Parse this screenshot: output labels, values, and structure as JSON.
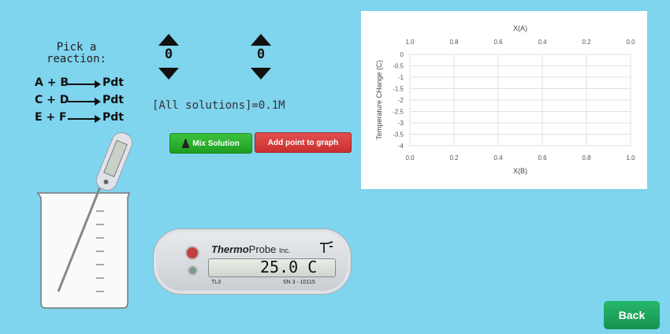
{
  "reaction_picker": {
    "prompt": "Pick a\nreaction:",
    "reactions": [
      {
        "reactants": "A + B",
        "product": "Pdt"
      },
      {
        "reactants": "C + D",
        "product": "Pdt"
      },
      {
        "reactants": "E + F",
        "product": "Pdt"
      }
    ]
  },
  "steppers": [
    {
      "value": "0"
    },
    {
      "value": "0"
    }
  ],
  "concentration_label": "[All solutions]=0.1M",
  "buttons": {
    "mix_solution": "Mix Solution",
    "add_point": "Add point to graph",
    "back": "Back"
  },
  "thermoprobe": {
    "brand_bold": "Thermo",
    "brand_rest": "Probe",
    "brand_suffix": "Inc.",
    "reading": "25.0 C",
    "model": "TL3",
    "serial": "SN 3 - 10115"
  },
  "chart_data": {
    "type": "scatter",
    "title": "",
    "xlabel": "X(B)",
    "x2label": "X(A)",
    "ylabel": "Temperature CHange (C)",
    "xlim": [
      0,
      1
    ],
    "x2lim": [
      1,
      0
    ],
    "ylim": [
      -4,
      0
    ],
    "xticks": [
      "0.0",
      "0.2",
      "0.4",
      "0.6",
      "0.8",
      "1.0"
    ],
    "x2ticks": [
      "1.0",
      "0.8",
      "0.6",
      "0.4",
      "0.2",
      "0.0"
    ],
    "yticks": [
      "0",
      "-0.5",
      "-1",
      "-1.5",
      "-2",
      "-2.5",
      "-3",
      "-3.5",
      "-4"
    ],
    "grid": true,
    "series": []
  },
  "colors": {
    "background": "#7fd4ee",
    "mix_button": "#2bb32f",
    "add_button": "#d63b3b",
    "back_button": "#1fa75c"
  }
}
